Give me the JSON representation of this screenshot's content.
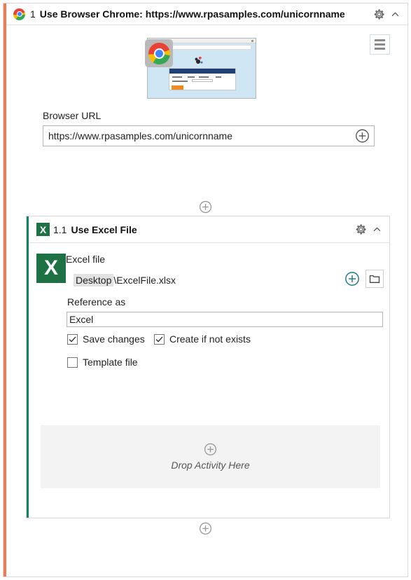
{
  "browser_card": {
    "icon": "chrome-logo-icon",
    "step_number": "1",
    "title": "Use Browser Chrome: https://www.rpasamples.com/unicornname",
    "gear_icon": "gear-icon",
    "collapse_icon": "chevron-up-icon",
    "thumbnail_alt": "browser-preview-thumbnail",
    "list_button_icon": "hamburger-menu-icon",
    "url_field": {
      "label": "Browser URL",
      "value": "https://www.rpasamples.com/unicornname",
      "placeholder": "Browser URL",
      "add_icon": "plus-circle-icon"
    }
  },
  "connectors": {
    "top_plus_icon": "plus-circle-icon",
    "bottom_plus_icon": "plus-circle-icon"
  },
  "excel_card": {
    "badge": "X",
    "step_number": "1.1",
    "title": "Use Excel File",
    "gear_icon": "gear-icon",
    "collapse_icon": "chevron-up-icon",
    "excel_file": {
      "label": "Excel file",
      "chip": "Desktop",
      "rest": "\\ExcelFile.xlsx",
      "add_icon": "plus-circle-icon",
      "browse_icon": "folder-icon"
    },
    "reference": {
      "label": "Reference as",
      "value": "Excel",
      "placeholder": "Reference as"
    },
    "checkboxes": [
      {
        "label": "Save changes",
        "checked": true
      },
      {
        "label": "Create if not exists",
        "checked": true
      },
      {
        "label": "Template file",
        "checked": false
      }
    ],
    "dropzone": {
      "plus_icon": "plus-circle-icon",
      "text": "Drop Activity Here"
    }
  },
  "colors": {
    "accent_orange": "#f4794f",
    "accent_teal": "#13806a",
    "excel_green": "#1e7145",
    "plus_teal": "#1b7b8c",
    "dropzone_bg": "#f3f3f3"
  }
}
